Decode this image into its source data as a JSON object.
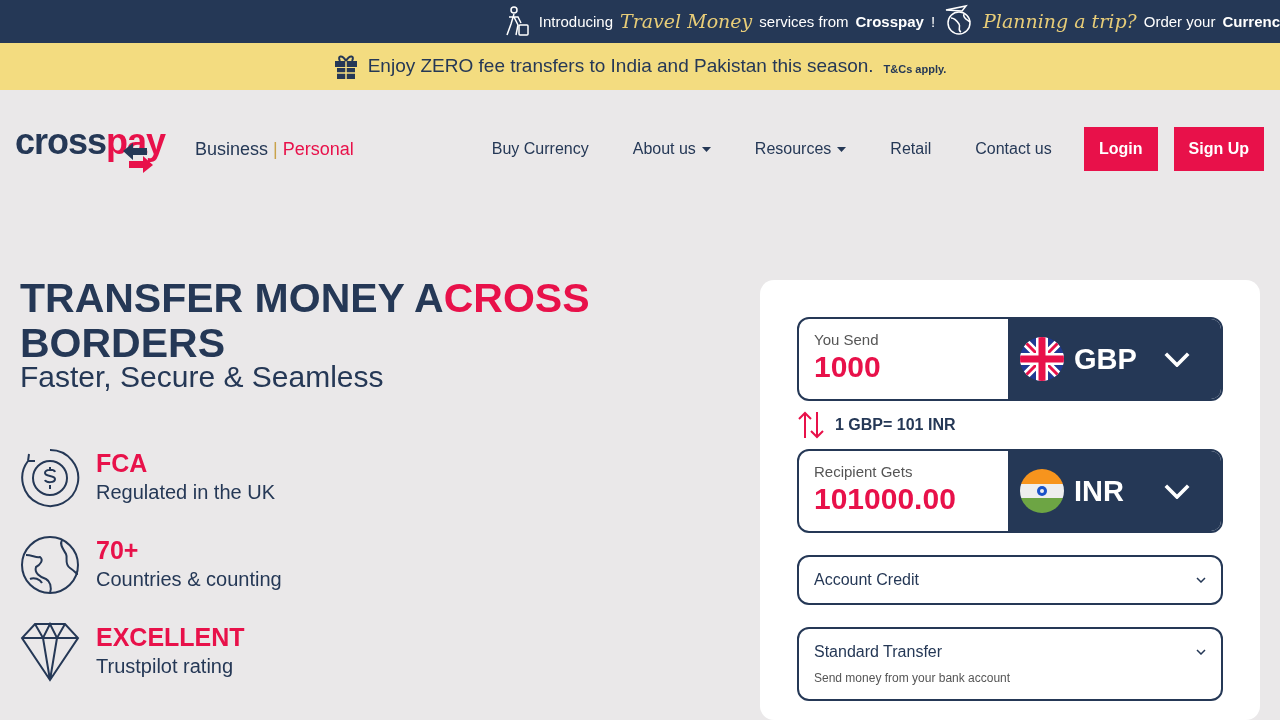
{
  "ticker": [
    {
      "text": "Introducing",
      "kind": "plain"
    },
    {
      "text": "Travel Money",
      "kind": "script"
    },
    {
      "text": "services from",
      "kind": "plain"
    },
    {
      "text": "Crosspay",
      "kind": "bold"
    },
    {
      "text": "!",
      "kind": "plain"
    },
    {
      "text": "Planning a trip?",
      "kind": "script"
    },
    {
      "text": "Order your",
      "kind": "plain"
    },
    {
      "text": "Currenc",
      "kind": "bold"
    }
  ],
  "promo": {
    "text": "Enjoy ZERO fee transfers to India and Pakistan this season.",
    "note": "T&Cs apply."
  },
  "header": {
    "logo": [
      {
        "text": "cross",
        "accent": false
      },
      {
        "text": "pay",
        "accent": true
      }
    ],
    "segments": [
      {
        "label": "Business",
        "selected": false
      },
      {
        "label": "|",
        "kind": "divider"
      },
      {
        "label": "Personal",
        "selected": true
      }
    ],
    "nav": [
      {
        "label": "Buy Currency",
        "dropdown": false
      },
      {
        "label": "About us",
        "dropdown": true
      },
      {
        "label": "Resources",
        "dropdown": true
      },
      {
        "label": "Retail",
        "dropdown": false
      },
      {
        "label": "Contact us",
        "dropdown": false
      }
    ],
    "buttons": [
      "Login",
      "Sign Up"
    ]
  },
  "hero": {
    "title_lines": [
      [
        {
          "text": "TRANSFER MONEY A",
          "accent": false
        },
        {
          "text": "CROSS",
          "accent": true
        }
      ],
      [
        {
          "text": "BORDERS",
          "accent": false
        }
      ]
    ],
    "subtitle": "Faster, Secure & Seamless",
    "features": [
      {
        "kind": "coin",
        "title": "FCA",
        "text": "Regulated in the UK"
      },
      {
        "kind": "globe",
        "title": "70+",
        "text": "Countries & counting"
      },
      {
        "kind": "diamond",
        "title": "EXCELLENT",
        "text": "Trustpilot rating"
      }
    ]
  },
  "converter": {
    "send": {
      "label": "You Send",
      "value": "1000",
      "currency": "GBP"
    },
    "rate": "1 GBP= 101 INR",
    "receive": {
      "label": "Recipient Gets",
      "value": "101000.00",
      "currency": "INR"
    },
    "method": "Account Credit",
    "speed": {
      "label": "Standard Transfer",
      "hint": "Send money from your bank account"
    }
  }
}
